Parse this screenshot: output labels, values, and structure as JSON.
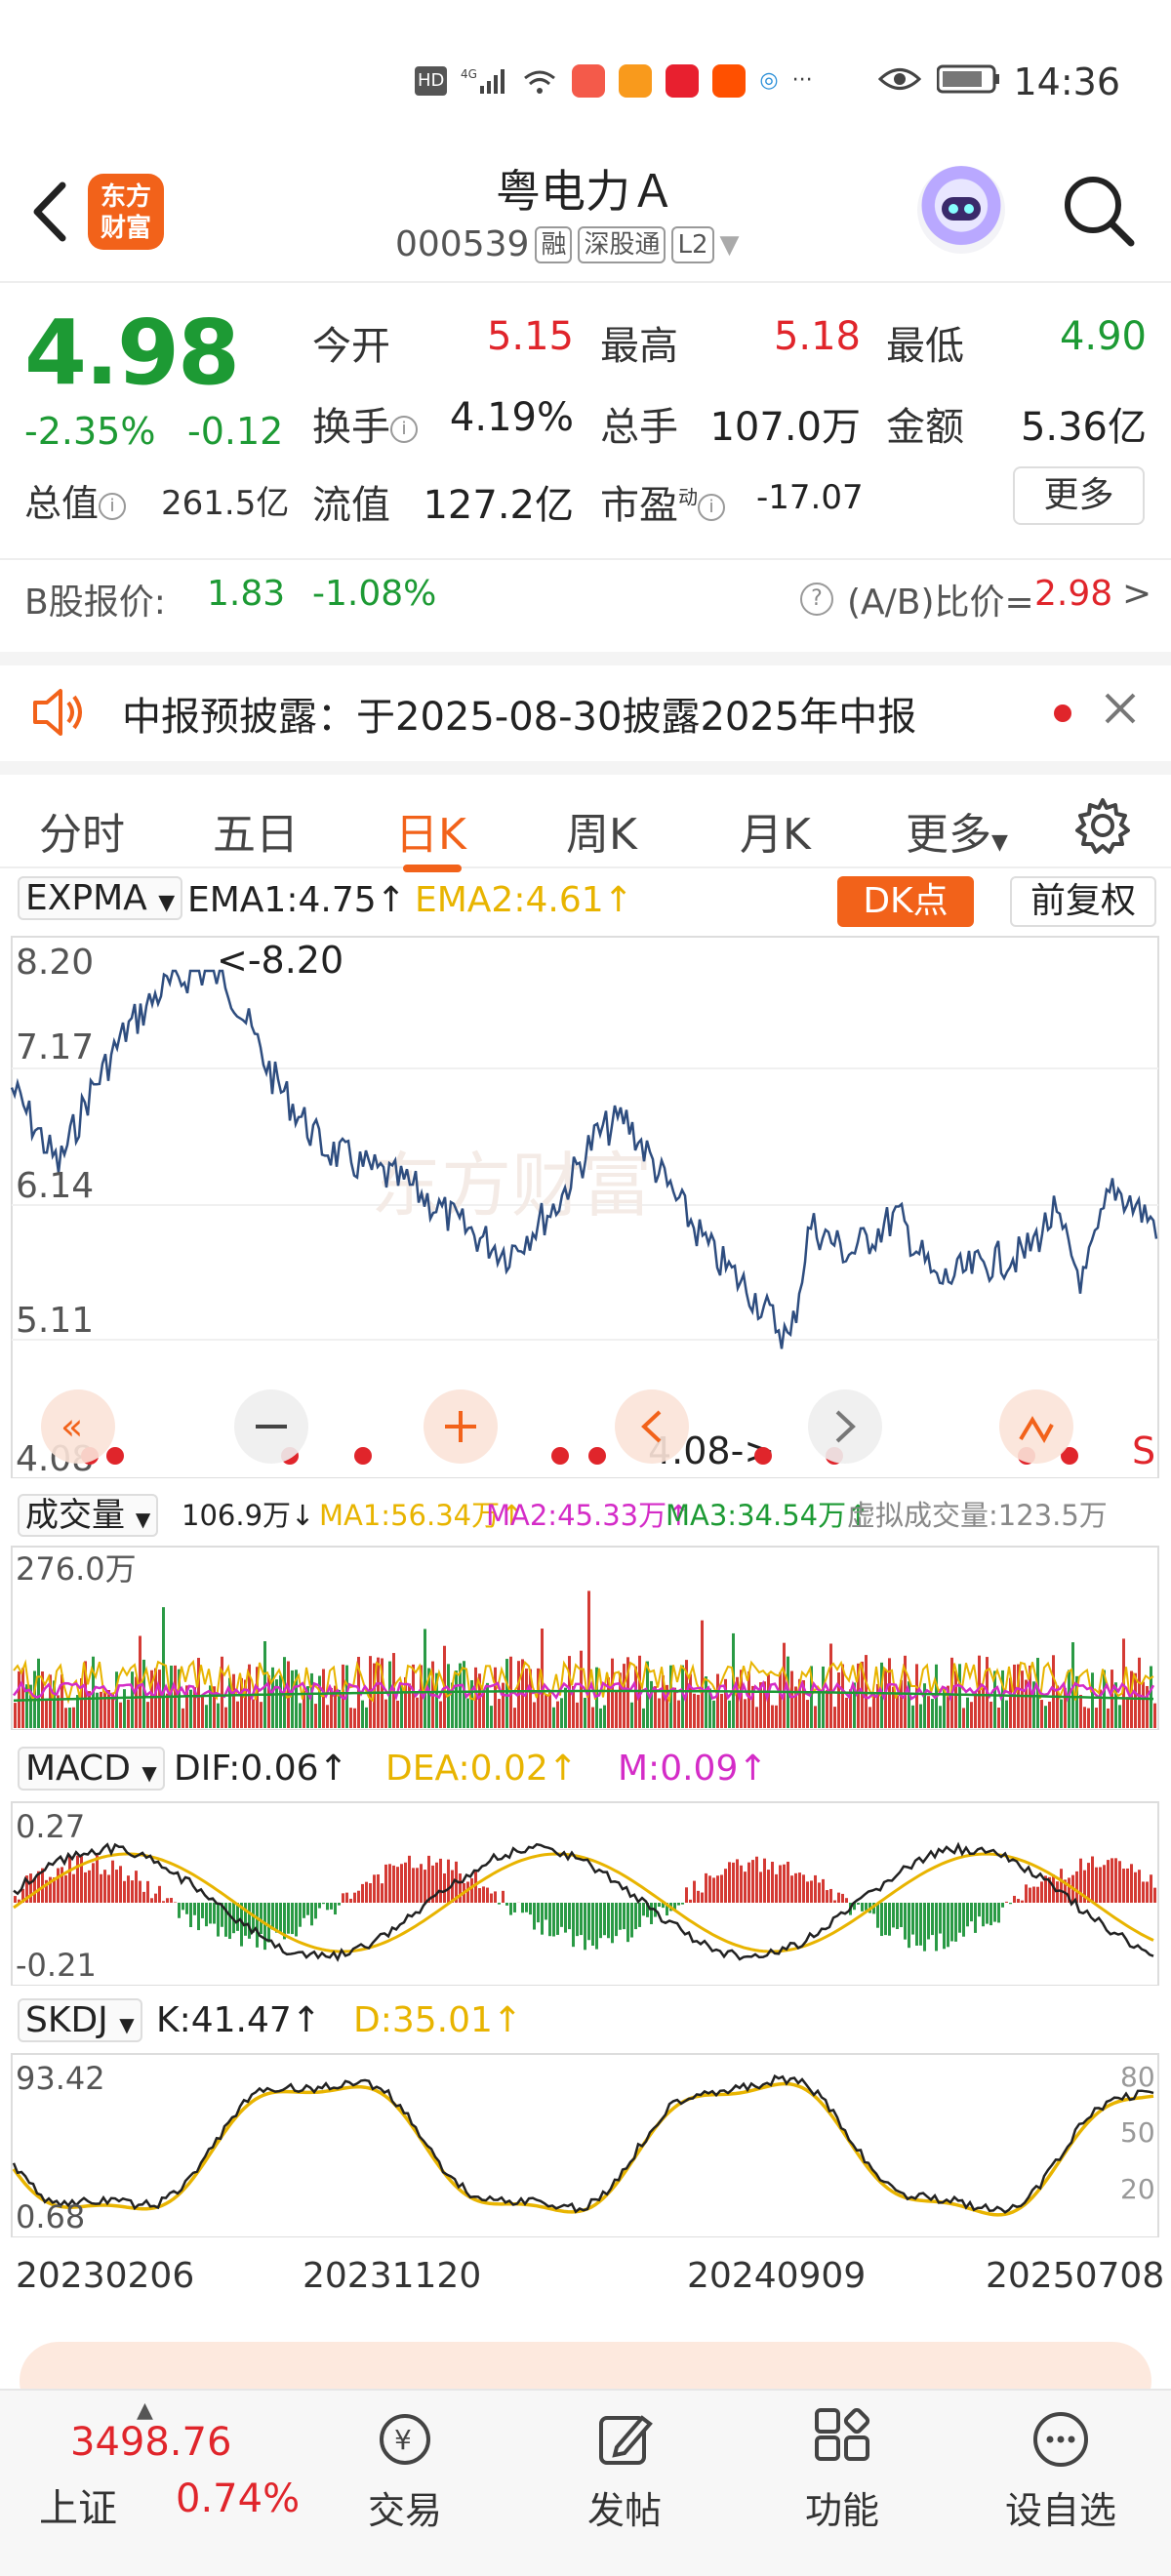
{
  "status_bar": {
    "time": "14:36",
    "network": "4G",
    "signal_label": "HD",
    "icons": [
      "hd-icon",
      "signal-icon",
      "wifi-icon",
      "huawei-app-icon",
      "notification-app-icon",
      "xiaohongshu-app-icon",
      "taobao-app-icon",
      "app-icon",
      "more-dots",
      "eye-icon",
      "battery-icon"
    ]
  },
  "header": {
    "logo_line1": "东方",
    "logo_line2": "财富",
    "stock_name": "粤电力Ａ",
    "stock_code": "000539",
    "tags": [
      "融",
      "深股通",
      "L2"
    ]
  },
  "quote": {
    "price": "4.98",
    "change_pct": "-2.35%",
    "change": "-0.12",
    "open_label": "今开",
    "open": "5.15",
    "high_label": "最高",
    "high": "5.18",
    "low_label": "最低",
    "low": "4.90",
    "turnover_label": "换手",
    "turnover": "4.19%",
    "volume_label": "总手",
    "volume": "107.0万",
    "amount_label": "金额",
    "amount": "5.36亿",
    "mktcap_label": "总值",
    "mktcap": "261.5亿",
    "float_label": "流值",
    "float": "127.2亿",
    "pe_label": "市盈",
    "pe_sup": "动",
    "pe": "-17.07",
    "more_button": "更多"
  },
  "b_share": {
    "label": "B股报价:",
    "price": "1.83",
    "change_pct": "-1.08%",
    "ratio_label": "(A/B)比价=",
    "ratio": "2.98",
    "arrow": ">"
  },
  "notice": {
    "text": "中报预披露：于2025-08-30披露2025年中报"
  },
  "tabs": [
    "分时",
    "五日",
    "日K",
    "周K",
    "月K",
    "更多"
  ],
  "active_tab": "日K",
  "kline": {
    "indicator": "EXPMA",
    "ema1": "EMA1:4.75",
    "ema2": "EMA2:4.61",
    "dk_button": "DK点",
    "adjust_button": "前复权",
    "y_labels": [
      "8.20",
      "7.17",
      "6.14",
      "5.11",
      "4.08"
    ],
    "max_marker": "<-8.20",
    "min_marker": "4.08->",
    "watermark": "东方财富",
    "signal": "S"
  },
  "volume": {
    "indicator": "成交量",
    "value": "106.9万",
    "ma1": "MA1:56.34万",
    "ma2": "MA2:45.33万",
    "ma3": "MA3:34.54万",
    "virtual": "虚拟成交量:123.5万",
    "y_top": "276.0万"
  },
  "macd": {
    "indicator": "MACD",
    "dif": "DIF:0.06",
    "dea": "DEA:0.02",
    "m": "M:0.09",
    "y_top": "0.27",
    "y_bottom": "-0.21"
  },
  "skdj": {
    "indicator": "SKDJ",
    "k": "K:41.47",
    "d": "D:35.01",
    "y_top": "93.42",
    "y_bottom": "0.68",
    "right_labels": [
      "80",
      "50",
      "20"
    ]
  },
  "x_dates": [
    "20230206",
    "20231120",
    "20240909",
    "20250708"
  ],
  "bottom_nav": {
    "index_value": "3498.76",
    "index_name": "上证",
    "index_change": "0.74%",
    "items": [
      "交易",
      "发帖",
      "功能",
      "设自选"
    ]
  },
  "colors": {
    "accent": "#f2621a",
    "up": "#e0252b",
    "down": "#1d9a34",
    "line": "#2e4d7f",
    "ema2": "#e8b400",
    "ma2": "#d42cc7"
  }
}
